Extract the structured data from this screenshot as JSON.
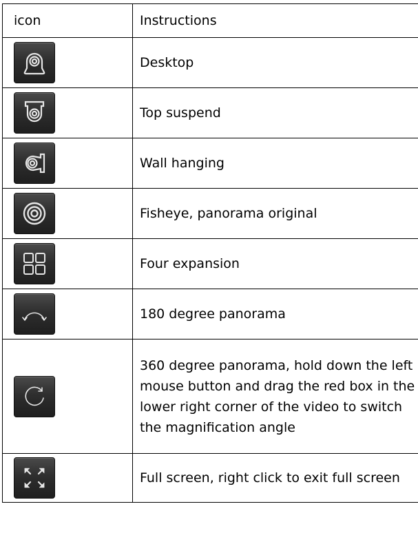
{
  "table": {
    "header": {
      "icon": "icon",
      "instructions": "Instructions"
    },
    "rows": [
      {
        "icon": "desktop-mount-icon",
        "text": "Desktop"
      },
      {
        "icon": "ceiling-mount-icon",
        "text": "Top suspend"
      },
      {
        "icon": "wall-mount-icon",
        "text": "Wall hanging"
      },
      {
        "icon": "fisheye-icon",
        "text": "Fisheye, panorama original"
      },
      {
        "icon": "four-grid-icon",
        "text": "Four expansion"
      },
      {
        "icon": "panorama-180-icon",
        "text": "180 degree panorama"
      },
      {
        "icon": "panorama-360-icon",
        "text": "360 degree panorama, hold down the left mouse button and drag the red box in the lower right corner of the video to switch the magnification angle"
      },
      {
        "icon": "fullscreen-icon",
        "text": "Full screen, right click to exit full screen"
      }
    ]
  }
}
